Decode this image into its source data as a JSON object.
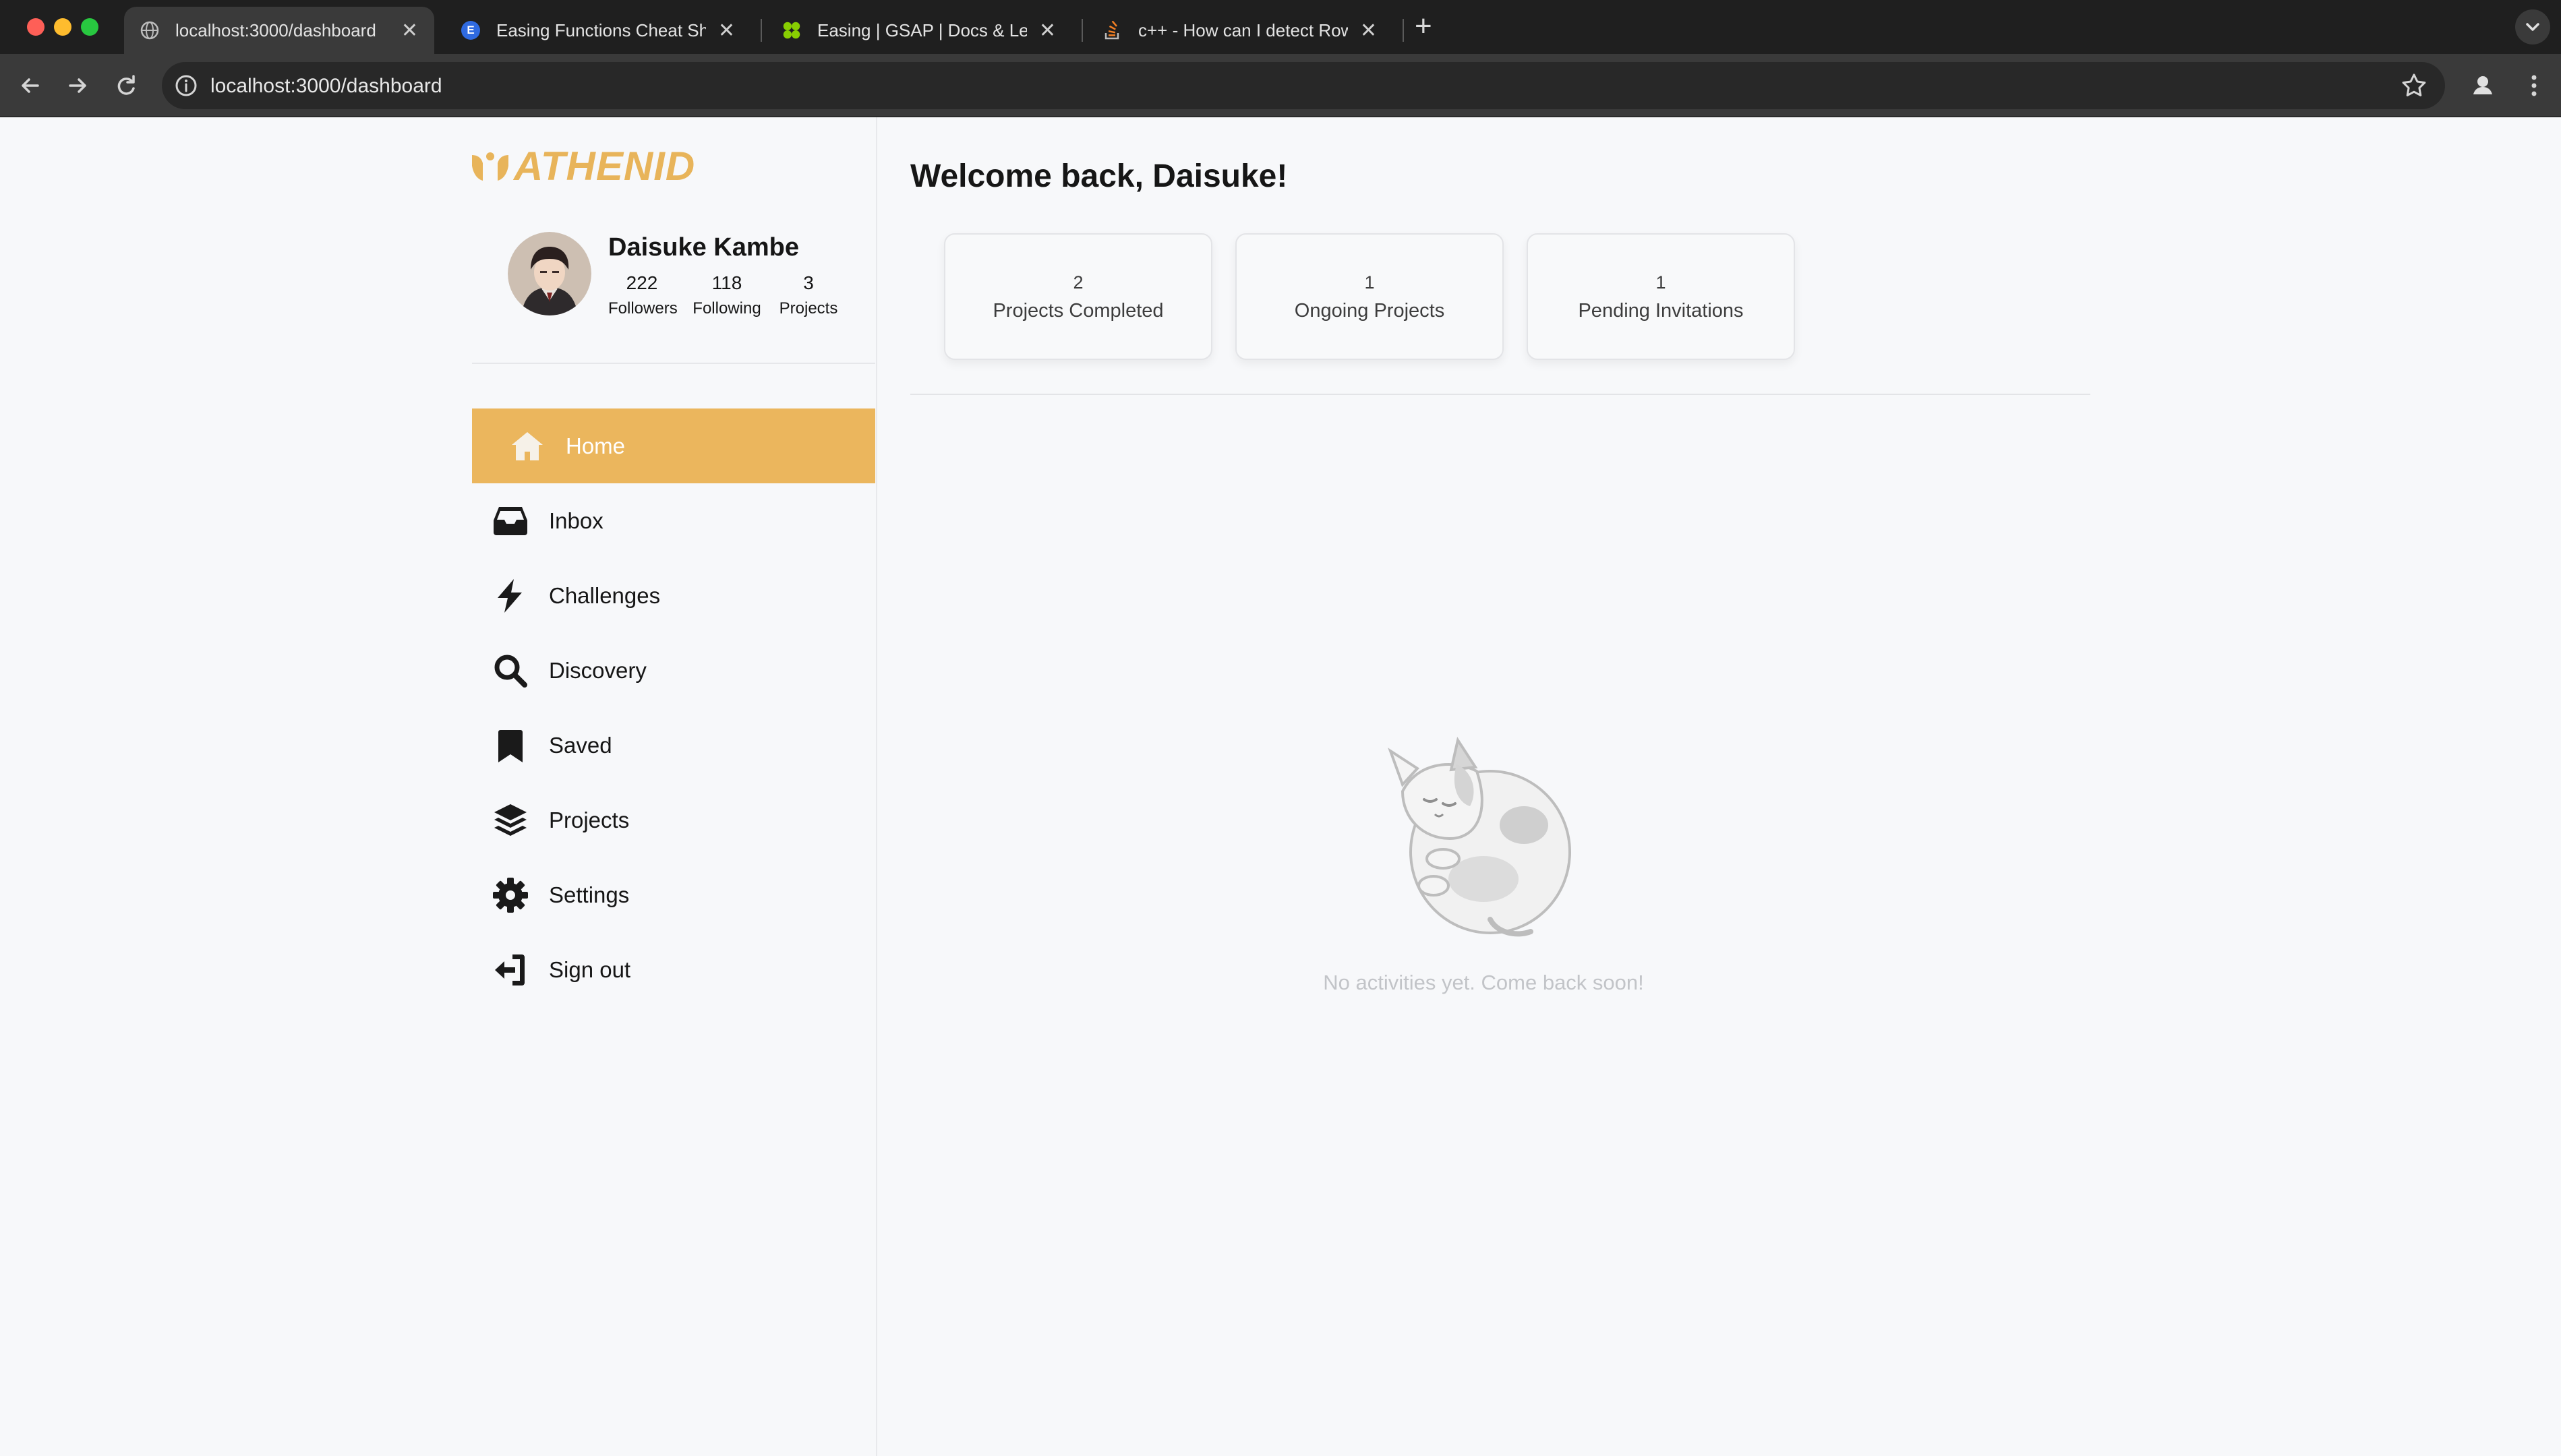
{
  "browser": {
    "tabs": [
      {
        "title": "localhost:3000/dashboard",
        "active": true
      },
      {
        "title": "Easing Functions Cheat Sheet",
        "active": false
      },
      {
        "title": "Easing | GSAP | Docs & Learning",
        "active": false
      },
      {
        "title": "c++ - How can I detect Rows",
        "active": false
      }
    ],
    "tab_favicons": [
      "E",
      "",
      ""
    ],
    "new_tab": "+",
    "url": "localhost:3000/dashboard",
    "close_glyph": "✕"
  },
  "brand": {
    "name": "ATHENID",
    "color": "#e8b45a"
  },
  "profile": {
    "name": "Daisuke Kambe",
    "stats": [
      {
        "value": "222",
        "label": "Followers"
      },
      {
        "value": "118",
        "label": "Following"
      },
      {
        "value": "3",
        "label": "Projects"
      }
    ]
  },
  "nav": {
    "items": [
      {
        "label": "Home",
        "icon": "home-icon",
        "active": true
      },
      {
        "label": "Inbox",
        "icon": "inbox-icon",
        "active": false
      },
      {
        "label": "Challenges",
        "icon": "lightning-icon",
        "active": false
      },
      {
        "label": "Discovery",
        "icon": "search-icon",
        "active": false
      },
      {
        "label": "Saved",
        "icon": "bookmark-icon",
        "active": false
      },
      {
        "label": "Projects",
        "icon": "layers-icon",
        "active": false
      },
      {
        "label": "Settings",
        "icon": "gear-icon",
        "active": false
      },
      {
        "label": "Sign out",
        "icon": "sign-out-icon",
        "active": false
      }
    ],
    "active_color": "#ebb65d"
  },
  "main": {
    "welcome": "Welcome back, Daisuke!",
    "cards": [
      {
        "value": "2",
        "label": "Projects Completed"
      },
      {
        "value": "1",
        "label": "Ongoing Projects"
      },
      {
        "value": "1",
        "label": "Pending Invitations"
      }
    ],
    "empty_message": "No activities yet. Come back soon!",
    "empty_icon": "sleeping-cat-illustration"
  }
}
